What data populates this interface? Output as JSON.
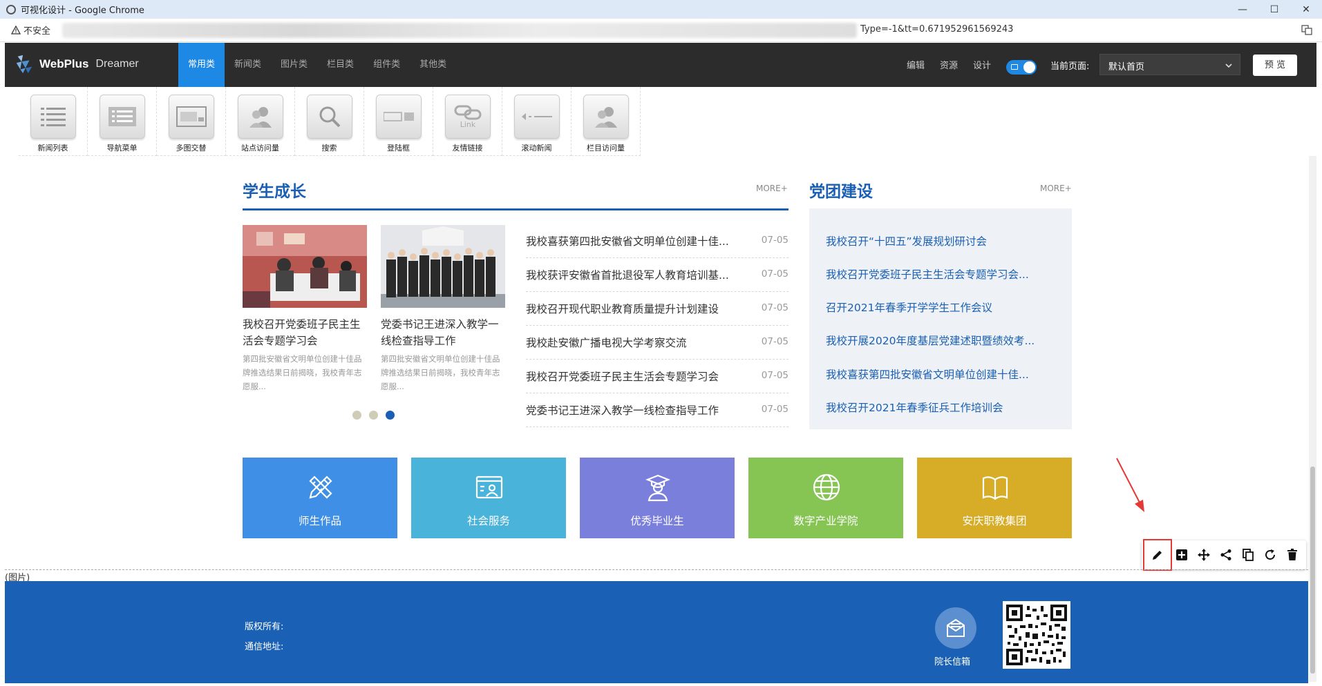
{
  "window": {
    "title": "可视化设计 - Google Chrome",
    "buttons": [
      "—",
      "☐",
      "✕"
    ]
  },
  "address": {
    "security_label": "不安全",
    "url_tail": "Type=-1&tt=0.671952961569243"
  },
  "editor": {
    "logo_main": "WebPlus",
    "logo_sub": "Dreamer",
    "categories": [
      "常用类",
      "新闻类",
      "图片类",
      "栏目类",
      "组件类",
      "其他类"
    ],
    "active_category": "常用类",
    "actions": [
      "编辑",
      "资源",
      "设计"
    ],
    "current_page_label": "当前页面:",
    "current_page_value": "默认首页",
    "preview_label": "预 览"
  },
  "palette": [
    {
      "label": "新闻列表",
      "icon": "list-icon"
    },
    {
      "label": "导航菜单",
      "icon": "menu-icon"
    },
    {
      "label": "多图交替",
      "icon": "slideshow-icon"
    },
    {
      "label": "站点访问量",
      "icon": "users-icon"
    },
    {
      "label": "搜索",
      "icon": "search-icon"
    },
    {
      "label": "登陆框",
      "icon": "login-icon"
    },
    {
      "label": "友情链接",
      "icon": "link-icon"
    },
    {
      "label": "滚动新闻",
      "icon": "scroll-icon"
    },
    {
      "label": "栏目访问量",
      "icon": "users-icon"
    }
  ],
  "student_growth": {
    "heading": "学生成长",
    "more": "MORE+",
    "cards": [
      {
        "title": "我校召开党委班子民主生活会专题学习会",
        "desc": "第四批安徽省文明单位创建十佳品牌推选结果日前揭晓，我校青年志愿服..."
      },
      {
        "title": "党委书记王进深入教学一线检查指导工作",
        "desc": "第四批安徽省文明单位创建十佳品牌推选结果日前揭晓，我校青年志愿服..."
      }
    ],
    "news": [
      {
        "title": "我校喜获第四批安徽省文明单位创建十佳...",
        "date": "07-05"
      },
      {
        "title": "我校获评安徽省首批退役军人教育培训基...",
        "date": "07-05"
      },
      {
        "title": "我校召开现代职业教育质量提升计划建设",
        "date": "07-05"
      },
      {
        "title": "我校赴安徽广播电视大学考察交流",
        "date": "07-05"
      },
      {
        "title": "我校召开党委班子民主生活会专题学习会",
        "date": "07-05"
      },
      {
        "title": "党委书记王进深入教学一线检查指导工作",
        "date": "07-05"
      }
    ]
  },
  "party": {
    "heading": "党团建设",
    "more": "MORE+",
    "links": [
      "我校召开“十四五”发展规划研讨会",
      "我校召开党委班子民主生活会专题学习会...",
      "召开2021年春季开学学生工作会议",
      "我校开展2020年度基层党建述职暨绩效考...",
      "我校喜获第四批安徽省文明单位创建十佳...",
      "我校召开2021年春季征兵工作培训会"
    ]
  },
  "features": [
    {
      "label": "师生作品",
      "color": "#3f8fe6",
      "icon": "pencil-ruler-icon"
    },
    {
      "label": "社会服务",
      "color": "#4ab3d9",
      "icon": "profile-card-icon"
    },
    {
      "label": "优秀毕业生",
      "color": "#7b7fdc",
      "icon": "graduate-icon"
    },
    {
      "label": "数字产业学院",
      "color": "#86c454",
      "icon": "globe-icon"
    },
    {
      "label": "安庆职教集团",
      "color": "#d7ac27",
      "icon": "book-icon"
    }
  ],
  "image_marker": "(图片)",
  "footer": {
    "copyright_label": "版权所有:",
    "address_label": "通信地址:",
    "mailbox_label": "院长信箱"
  },
  "colors": {
    "accent": "#1e88e5",
    "heading_blue": "#1a5fb4",
    "footer_bg": "#1a60b5",
    "editor_bar": "#2c2c2c",
    "highlight_red": "#e53935"
  }
}
